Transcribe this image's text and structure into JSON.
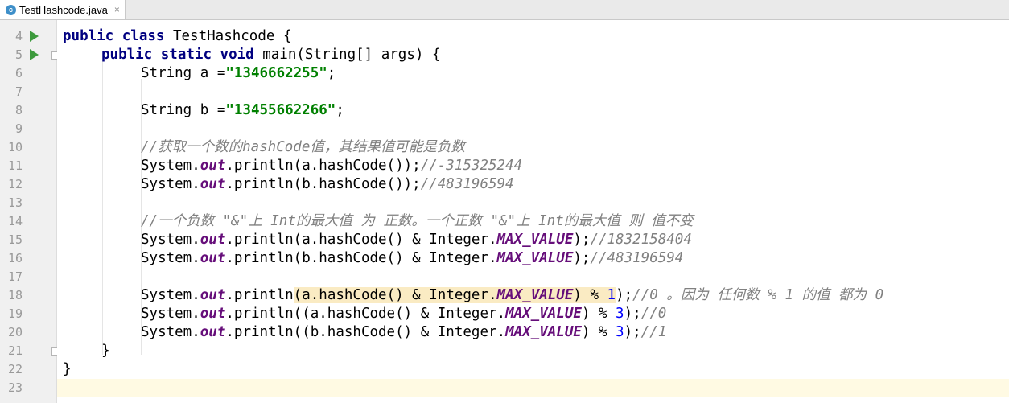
{
  "tab": {
    "icon": "java-class-icon",
    "icon_letter": "c",
    "title": "TestHashcode.java",
    "close": "×"
  },
  "line_numbers": [
    "4",
    "5",
    "6",
    "7",
    "8",
    "9",
    "10",
    "11",
    "12",
    "13",
    "14",
    "15",
    "16",
    "17",
    "18",
    "19",
    "20",
    "21",
    "22",
    "23"
  ],
  "code": {
    "l4": {
      "kw1": "public",
      "kw2": "class",
      "rest": " TestHashcode {"
    },
    "l5": {
      "kw1": "public",
      "kw2": "static",
      "kw3": "void",
      "rest": " main(String[] args) {"
    },
    "l6": {
      "pre": "String a =",
      "str": "\"1346662255\"",
      "post": ";"
    },
    "l8": {
      "pre": "String b =",
      "str": "\"13455662266\"",
      "post": ";"
    },
    "l10": {
      "comment": "//获取一个数的hashCode值，其结果值可能是负数"
    },
    "l11": {
      "a": "System.",
      "out": "out",
      "b": ".println(a.hashCode());",
      "comment": "//-315325244"
    },
    "l12": {
      "a": "System.",
      "out": "out",
      "b": ".println(b.hashCode());",
      "comment": "//483196594"
    },
    "l14": {
      "comment": "//一个负数 \"&\"上 Int的最大值 为 正数。一个正数 \"&\"上 Int的最大值 则 值不变"
    },
    "l15": {
      "a": "System.",
      "out": "out",
      "b": ".println(a.hashCode() & Integer.",
      "max": "MAX_VALUE",
      "c": ");",
      "comment": "//1832158404"
    },
    "l16": {
      "a": "System.",
      "out": "out",
      "b": ".println(b.hashCode() & Integer.",
      "max": "MAX_VALUE",
      "c": ");",
      "comment": "//483196594"
    },
    "l18": {
      "a": "System.",
      "out": "out",
      "b": ".println",
      "hl1": "(a.hashCode() & Integer.",
      "max": "MAX_VALUE",
      "hl2": ") % ",
      "num": "1",
      "c": ");",
      "comment": "//0 。因为 任何数 % 1 的值 都为 0"
    },
    "l19": {
      "a": "System.",
      "out": "out",
      "b": ".println((a.hashCode() & Integer.",
      "max": "MAX_VALUE",
      "c": ") % ",
      "num": "3",
      "d": ");",
      "comment": "//0"
    },
    "l20": {
      "a": "System.",
      "out": "out",
      "b": ".println((b.hashCode() & Integer.",
      "max": "MAX_VALUE",
      "c": ") % ",
      "num": "3",
      "d": ");",
      "comment": "//1"
    },
    "l21": {
      "text": "}"
    },
    "l22": {
      "text": "}"
    }
  },
  "colors": {
    "keyword": "#000080",
    "string": "#008000",
    "comment": "#808080",
    "static_field": "#660e7a",
    "number": "#0000ff",
    "run_icon": "#3c9a3c",
    "highlight": "#faebc3"
  },
  "icons": [
    "java-class-icon",
    "run-arrow-icon",
    "fold-icon",
    "close-icon"
  ]
}
